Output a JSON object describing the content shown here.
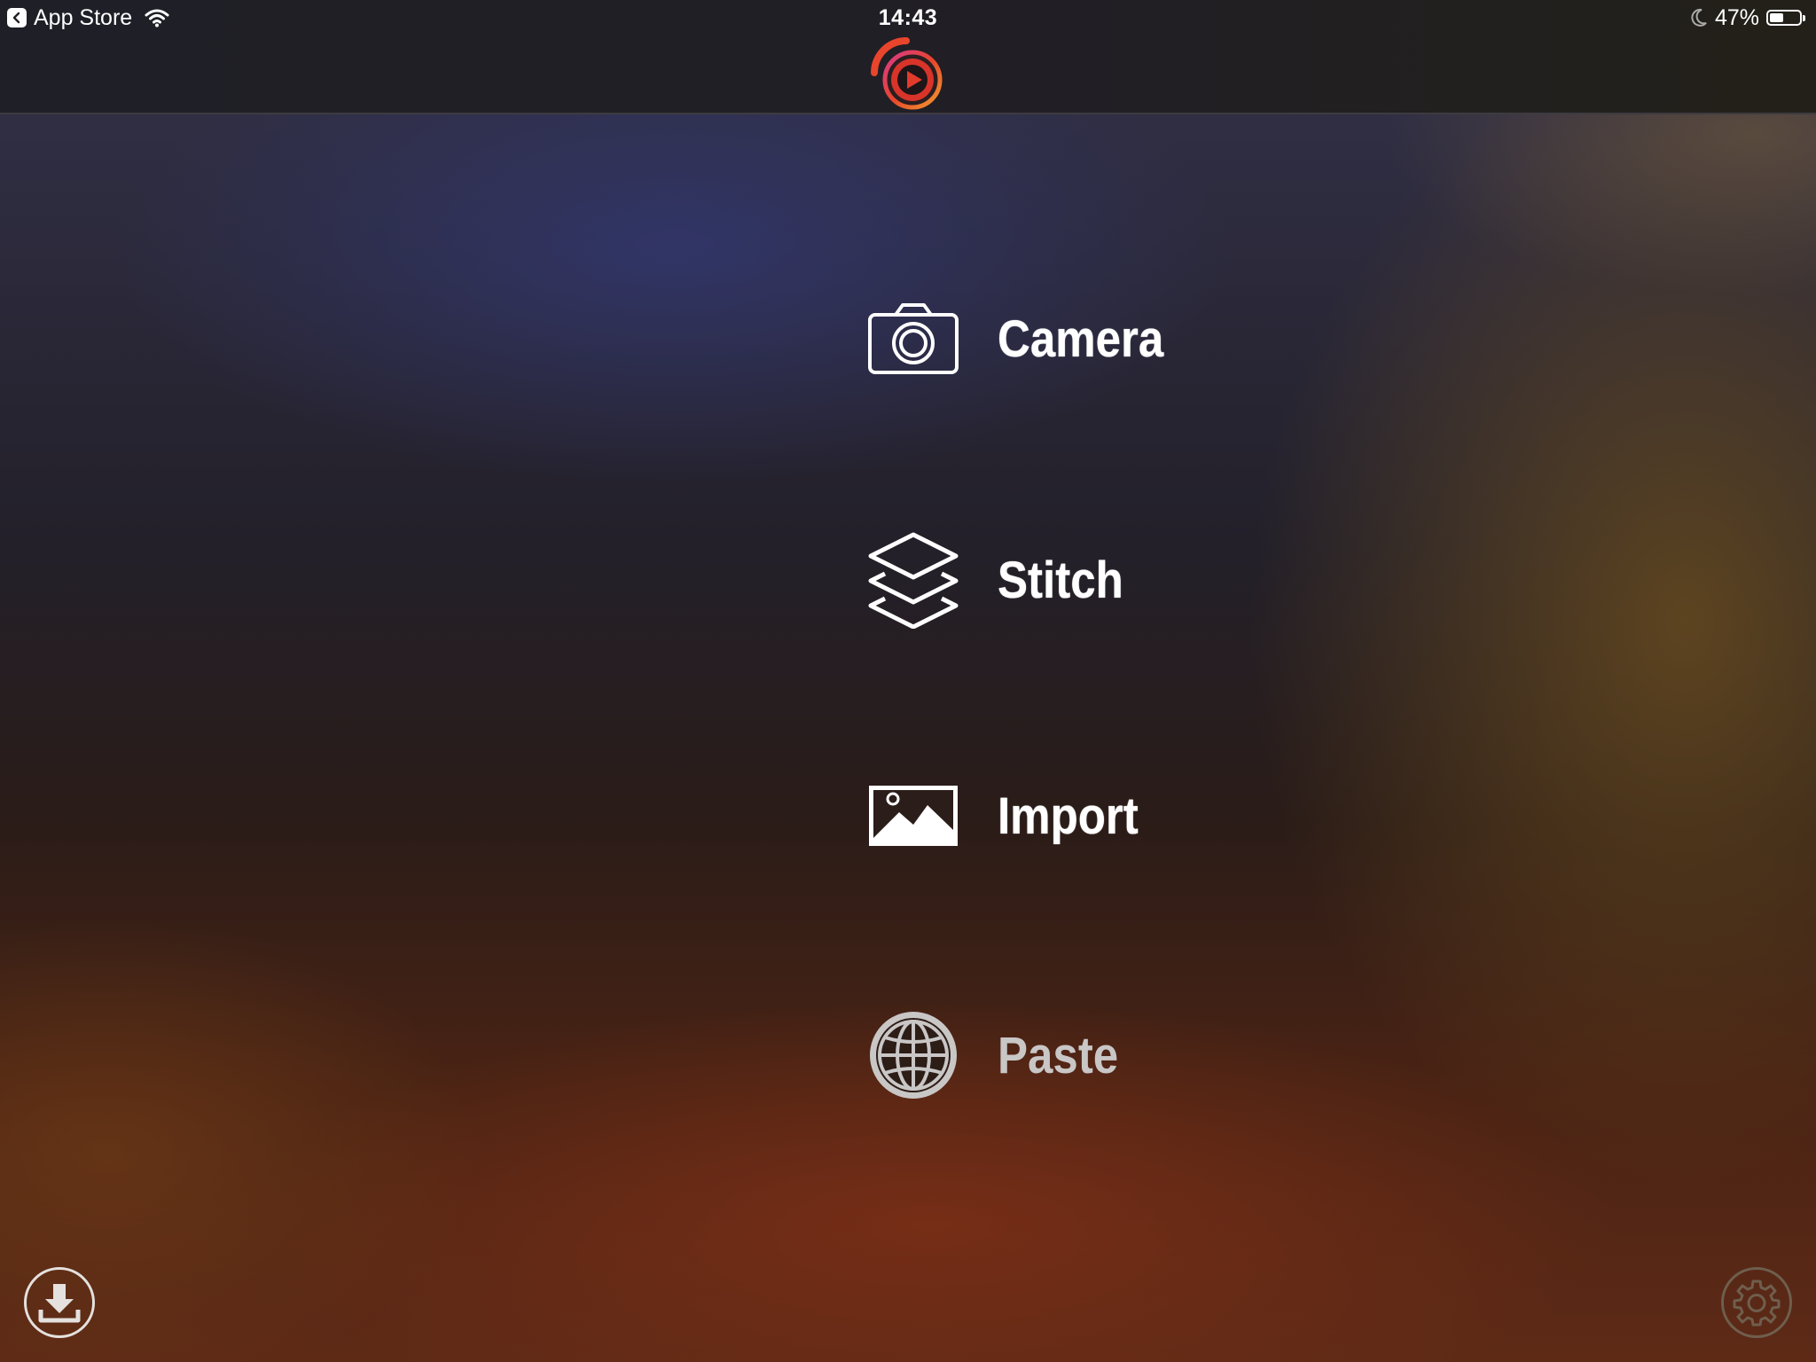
{
  "status_bar": {
    "back_app": "App Store",
    "time": "14:43",
    "battery_percent": "47%",
    "battery_level": 0.47
  },
  "header": {
    "logo_icon": "app-logo-icon",
    "accent_colors": [
      "#e8452c",
      "#d93a8a",
      "#f29a2e"
    ]
  },
  "menu": {
    "items": [
      {
        "label": "Camera",
        "icon": "camera-icon",
        "enabled": true
      },
      {
        "label": "Stitch",
        "icon": "layers-icon",
        "enabled": true
      },
      {
        "label": "Import",
        "icon": "image-icon",
        "enabled": true
      },
      {
        "label": "Paste",
        "icon": "globe-icon",
        "enabled": false
      }
    ]
  },
  "footer": {
    "left_icon": "download-icon",
    "right_icon": "gear-icon"
  }
}
